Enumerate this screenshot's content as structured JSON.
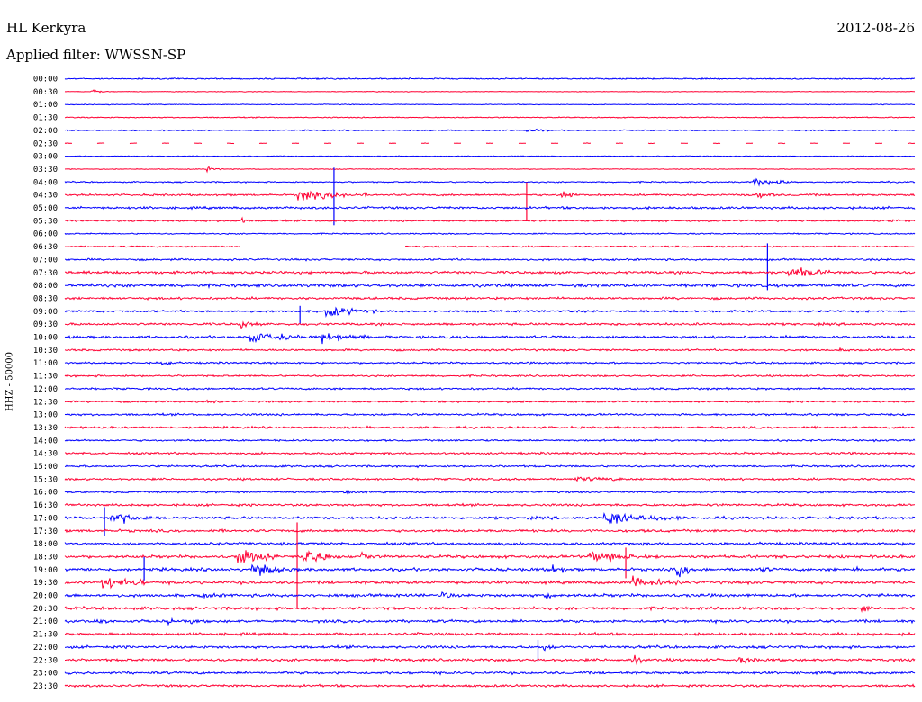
{
  "header": {
    "station": "HL Kerkyra",
    "date": "2012-08-26",
    "filter": "Applied filter: WWSSN-SP",
    "channel": "HHZ - 50000"
  },
  "colors": {
    "even_row": "#0000ff",
    "odd_row": "#ff0033"
  },
  "chart_data": {
    "type": "line",
    "title": "HL Kerkyra",
    "subtitle": "Applied filter: WWSSN-SP",
    "ylabel": "HHZ - 50000",
    "row_labels": [
      "00:00",
      "00:30",
      "01:00",
      "01:30",
      "02:00",
      "02:30",
      "03:00",
      "03:30",
      "04:00",
      "04:30",
      "05:00",
      "05:30",
      "06:00",
      "06:30",
      "07:00",
      "07:30",
      "08:00",
      "08:30",
      "09:00",
      "09:30",
      "10:00",
      "10:30",
      "11:00",
      "11:30",
      "12:00",
      "12:30",
      "13:00",
      "13:30",
      "14:00",
      "14:30",
      "15:00",
      "15:30",
      "16:00",
      "16:30",
      "17:00",
      "17:30",
      "18:00",
      "18:30",
      "19:00",
      "19:30",
      "20:00",
      "20:30",
      "21:00",
      "21:30",
      "22:00",
      "22:30",
      "23:00",
      "23:30"
    ],
    "x_range_minutes": [
      0,
      30
    ],
    "grid": false,
    "noise_level": [
      1,
      0.5,
      0.6,
      0.8,
      0.9,
      0.5,
      0.6,
      0.6,
      1,
      1.5,
      1.8,
      1.4,
      1,
      1.2,
      1.5,
      2,
      2.4,
      1.8,
      1.6,
      1.8,
      2,
      1.5,
      1.4,
      1.4,
      1.5,
      1.4,
      1.6,
      1.6,
      1.4,
      1.6,
      1.5,
      1.6,
      1.4,
      1.8,
      2,
      2,
      2,
      2.2,
      2.3,
      2.2,
      2.3,
      2.2,
      2.1,
      2.1,
      2,
      2,
      1.9,
      1.8
    ],
    "events": [
      {
        "row": 1,
        "t": 0.9,
        "dur": 0.6,
        "amp": 4
      },
      {
        "row": 4,
        "t": 16.3,
        "dur": 0.8,
        "amp": 3
      },
      {
        "row": 7,
        "t": 5.0,
        "dur": 0.6,
        "amp": 5
      },
      {
        "row": 8,
        "t": 24.3,
        "dur": 1.5,
        "amp": 9
      },
      {
        "row": 9,
        "t": 8.2,
        "dur": 2.5,
        "amp": 12
      },
      {
        "row": 9,
        "t": 17.5,
        "dur": 0.6,
        "amp": 12
      },
      {
        "row": 9,
        "t": 24.4,
        "dur": 0.7,
        "amp": 6
      },
      {
        "row": 11,
        "t": 6.2,
        "dur": 0.3,
        "amp": 6
      },
      {
        "row": 11,
        "t": 29.2,
        "dur": 0.4,
        "amp": 4
      },
      {
        "row": 15,
        "t": 25.5,
        "dur": 1.5,
        "amp": 11
      },
      {
        "row": 18,
        "t": 9.2,
        "dur": 1.8,
        "amp": 10
      },
      {
        "row": 19,
        "t": 6.2,
        "dur": 0.6,
        "amp": 9
      },
      {
        "row": 19,
        "t": 32.8,
        "dur": 0.2,
        "amp": 9
      },
      {
        "row": 20,
        "t": 6.5,
        "dur": 1.8,
        "amp": 12
      },
      {
        "row": 20,
        "t": 9.0,
        "dur": 1.6,
        "amp": 12
      },
      {
        "row": 21,
        "t": 27.2,
        "dur": 0.5,
        "amp": 4
      },
      {
        "row": 22,
        "t": 3.4,
        "dur": 0.6,
        "amp": 3
      },
      {
        "row": 25,
        "t": 5.0,
        "dur": 0.5,
        "amp": 2
      },
      {
        "row": 31,
        "t": 18.0,
        "dur": 2.2,
        "amp": 4
      },
      {
        "row": 32,
        "t": 9.8,
        "dur": 0.6,
        "amp": 4
      },
      {
        "row": 34,
        "t": 1.6,
        "dur": 1.6,
        "amp": 12
      },
      {
        "row": 34,
        "t": 19.0,
        "dur": 2.8,
        "amp": 12
      },
      {
        "row": 37,
        "t": 6.1,
        "dur": 1.8,
        "amp": 16
      },
      {
        "row": 37,
        "t": 8.4,
        "dur": 1.3,
        "amp": 18
      },
      {
        "row": 37,
        "t": 10.4,
        "dur": 0.5,
        "amp": 10
      },
      {
        "row": 37,
        "t": 18.5,
        "dur": 2.5,
        "amp": 10
      },
      {
        "row": 38,
        "t": 6.6,
        "dur": 1.4,
        "amp": 14
      },
      {
        "row": 38,
        "t": 17.2,
        "dur": 0.6,
        "amp": 12
      },
      {
        "row": 38,
        "t": 21.6,
        "dur": 0.6,
        "amp": 14
      },
      {
        "row": 38,
        "t": 24.6,
        "dur": 0.4,
        "amp": 6
      },
      {
        "row": 38,
        "t": 27.8,
        "dur": 0.3,
        "amp": 10
      },
      {
        "row": 39,
        "t": 1.3,
        "dur": 1.8,
        "amp": 12
      },
      {
        "row": 39,
        "t": 20.0,
        "dur": 1.8,
        "amp": 9
      },
      {
        "row": 40,
        "t": 4.8,
        "dur": 0.6,
        "amp": 5
      },
      {
        "row": 40,
        "t": 13.3,
        "dur": 0.5,
        "amp": 6
      },
      {
        "row": 40,
        "t": 17.0,
        "dur": 0.4,
        "amp": 6
      },
      {
        "row": 41,
        "t": 28.1,
        "dur": 0.3,
        "amp": 10
      },
      {
        "row": 42,
        "t": 1.3,
        "dur": 0.3,
        "amp": 6
      },
      {
        "row": 42,
        "t": 3.6,
        "dur": 0.3,
        "amp": 8
      },
      {
        "row": 42,
        "t": 4.4,
        "dur": 0.3,
        "amp": 8
      },
      {
        "row": 44,
        "t": 16.9,
        "dur": 0.4,
        "amp": 8
      },
      {
        "row": 45,
        "t": 20.0,
        "dur": 0.4,
        "amp": 12
      },
      {
        "row": 45,
        "t": 23.8,
        "dur": 0.6,
        "amp": 7
      }
    ],
    "spikes": [
      {
        "row": 8,
        "t": 9.5,
        "up": 16,
        "down": 48
      },
      {
        "row": 9,
        "t": 16.3,
        "up": 14,
        "down": 28
      },
      {
        "row": 14,
        "t": 24.8,
        "up": 18,
        "down": 34
      },
      {
        "row": 18,
        "t": 8.3,
        "up": 6,
        "down": 14
      },
      {
        "row": 34,
        "t": 1.4,
        "up": 12,
        "down": 20
      },
      {
        "row": 37,
        "t": 8.2,
        "up": 38,
        "down": 58
      },
      {
        "row": 37,
        "t": 19.8,
        "up": 10,
        "down": 24
      },
      {
        "row": 38,
        "t": 2.8,
        "up": 14,
        "down": 12
      },
      {
        "row": 44,
        "t": 16.7,
        "up": 8,
        "down": 16
      }
    ],
    "gaps": [
      {
        "row": 5,
        "from": 0,
        "to": 30,
        "pattern": "dashed"
      },
      {
        "row": 13,
        "from": 6.2,
        "to": 12.0,
        "pattern": "gap"
      }
    ]
  }
}
